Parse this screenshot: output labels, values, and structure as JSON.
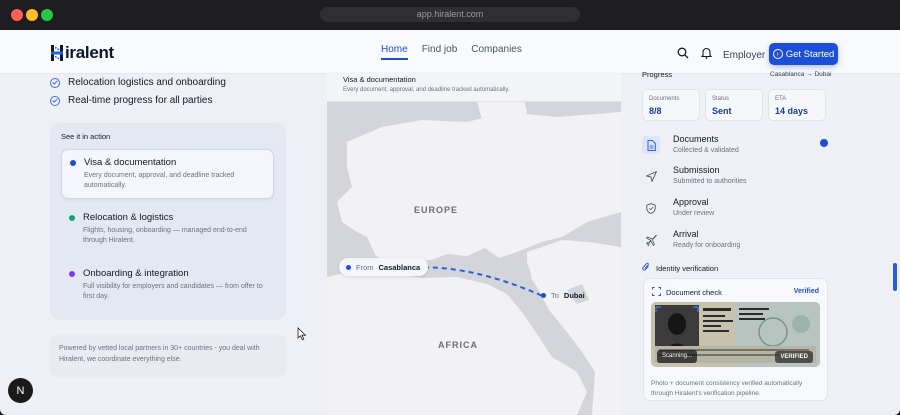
{
  "browser": {
    "url": "app.hiralent.com"
  },
  "nav": {
    "brand": "iralent",
    "brand_initial": "H",
    "links": [
      "Home",
      "Find job",
      "Companies"
    ],
    "active_link": "Home",
    "employer": "Employer",
    "cta": "Get Started"
  },
  "features": [
    "Relocation logistics and onboarding",
    "Real-time progress for all parties"
  ],
  "see_it": {
    "title": "See it in action",
    "steps": [
      {
        "title": "Visa & documentation",
        "desc": "Every document, approval, and deadline tracked automatically.",
        "color": "#1d4ed8"
      },
      {
        "title": "Relocation & logistics",
        "desc": "Flights, housing, onboarding — managed end-to-end through Hiralent.",
        "color": "#10a36a"
      },
      {
        "title": "Onboarding & integration",
        "desc": "Full visibility for employers and candidates — from offer to first day.",
        "color": "#7c3aed"
      }
    ]
  },
  "note": "Powered by vetted local partners in 30+ countries - you deal with Hiralent, we coordinate everything else.",
  "avatar": "N",
  "map": {
    "header_title": "Visa & documentation",
    "header_sub": "Every document, approval, and deadline tracked automatically.",
    "europe": "EUROPE",
    "africa": "AFRICA",
    "from_label": "From",
    "from_city": "Casablanca",
    "to_label": "To",
    "to_city": "Dubai"
  },
  "progress": {
    "title": "Progress",
    "route": "Casablanca → Dubai",
    "stats": [
      {
        "label": "Documents",
        "value": "8/8"
      },
      {
        "label": "Status",
        "value": "Sent"
      },
      {
        "label": "ETA",
        "value": "14 days"
      }
    ],
    "items": [
      {
        "title": "Documents",
        "sub": "Collected & validated",
        "icon": "document-icon"
      },
      {
        "title": "Submission",
        "sub": "Submitted to authorities",
        "icon": "send-icon"
      },
      {
        "title": "Approval",
        "sub": "Under review",
        "icon": "shield-icon"
      },
      {
        "title": "Arrival",
        "sub": "Ready for onboarding",
        "icon": "plane-icon"
      }
    ]
  },
  "identity": {
    "title": "Identity verification",
    "card_title": "Document check",
    "verified": "Verified",
    "scanning": "Scanning...",
    "stamp": "VERIFIED",
    "caption": "Photo + document consistency verified automatically through Hiralent's verification pipeline."
  },
  "colors": {
    "accent": "#1d4ed8",
    "background": "#eef0f6"
  }
}
